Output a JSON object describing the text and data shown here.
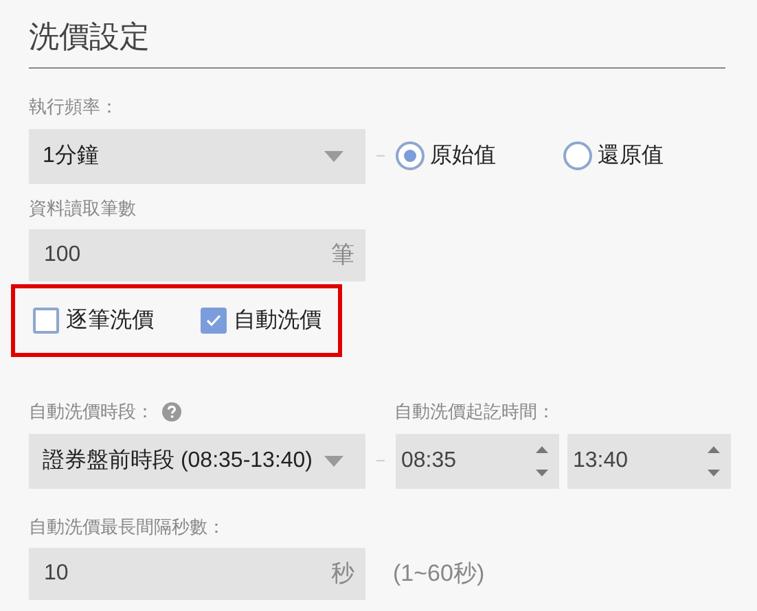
{
  "title": "洗價設定",
  "frequency": {
    "label": "執行頻率：",
    "value": "1分鐘"
  },
  "value_mode": [
    {
      "label": "原始值",
      "selected": true
    },
    {
      "label": "還原值",
      "selected": false
    }
  ],
  "record_count": {
    "label": "資料讀取筆數",
    "value": "100",
    "unit": "筆"
  },
  "price_options": {
    "highlighted": true,
    "items": [
      {
        "label": "逐筆洗價",
        "checked": false
      },
      {
        "label": "自動洗價",
        "checked": true
      }
    ]
  },
  "auto_period": {
    "label": "自動洗價時段：",
    "value": "證券盤前時段 (08:35-13:40)",
    "has_help": true
  },
  "auto_time": {
    "label": "自動洗價起訖時間：",
    "start": "08:35",
    "end": "13:40"
  },
  "max_interval": {
    "label": "自動洗價最長間隔秒數：",
    "value": "10",
    "unit": "秒",
    "hint": "(1~60秒)"
  }
}
